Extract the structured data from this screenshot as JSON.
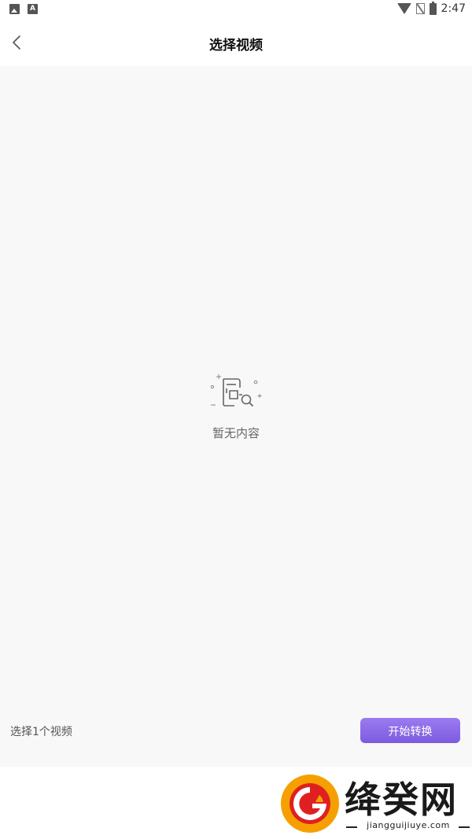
{
  "status_bar": {
    "time": "2:47",
    "left_icons": [
      "image-notification-icon",
      "text-notification-icon"
    ],
    "right_icons": [
      "wifi-icon",
      "no-sim-icon",
      "battery-charging-icon"
    ]
  },
  "header": {
    "title": "选择视频",
    "back_icon": "chevron-left-icon"
  },
  "empty_state": {
    "icon": "document-search-icon",
    "text": "暂无内容"
  },
  "bottom_bar": {
    "selected_count": "选择1个视频",
    "start_button": "开始转换"
  },
  "watermark": {
    "title": "绛癸网",
    "subtitle": "jiangguijiuye.com"
  },
  "colors": {
    "accent_gradient_top": "#9b7cf0",
    "accent_gradient_bottom": "#7d5ae0",
    "content_bg": "#f8f8f8",
    "logo_red": "#e02020",
    "logo_orange": "#f5a000"
  }
}
